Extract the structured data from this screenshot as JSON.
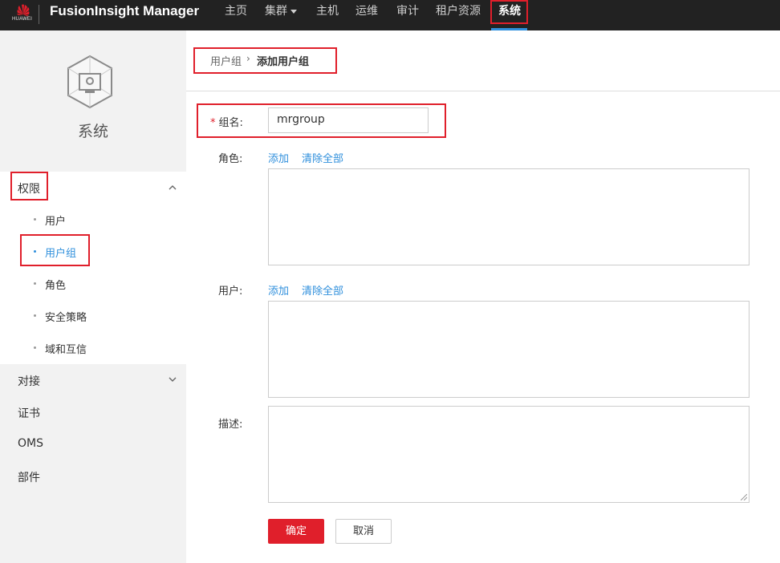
{
  "brand": {
    "logo_text": "HUAWEI",
    "app_title": "FusionInsight Manager"
  },
  "nav": {
    "items": [
      {
        "label": "主页"
      },
      {
        "label": "集群"
      },
      {
        "label": "主机"
      },
      {
        "label": "运维"
      },
      {
        "label": "审计"
      },
      {
        "label": "租户资源"
      },
      {
        "label": "系统"
      }
    ],
    "active": "系统"
  },
  "sidebar": {
    "title": "系统",
    "groups": {
      "permission": {
        "label": "权限",
        "subitems": [
          "用户",
          "用户组",
          "角色",
          "安全策略",
          "域和互信"
        ],
        "active_sub": "用户组"
      },
      "connect": "对接",
      "cert": "证书",
      "oms": "OMS",
      "component": "部件"
    }
  },
  "breadcrumb": {
    "parent": "用户组",
    "separator": "›",
    "current": "添加用户组"
  },
  "form": {
    "group_name": {
      "required_mark": "*",
      "label": "组名:",
      "value": "mrgroup"
    },
    "role": {
      "label": "角色:",
      "add": "添加",
      "clear": "清除全部"
    },
    "user": {
      "label": "用户:",
      "add": "添加",
      "clear": "清除全部"
    },
    "description": {
      "label": "描述:"
    },
    "confirm": "确定",
    "cancel": "取消"
  },
  "colors": {
    "accent": "#2f8fdc",
    "brand_red": "#e01f2b",
    "topbar": "#222222",
    "sidebar": "#f2f2f2"
  }
}
